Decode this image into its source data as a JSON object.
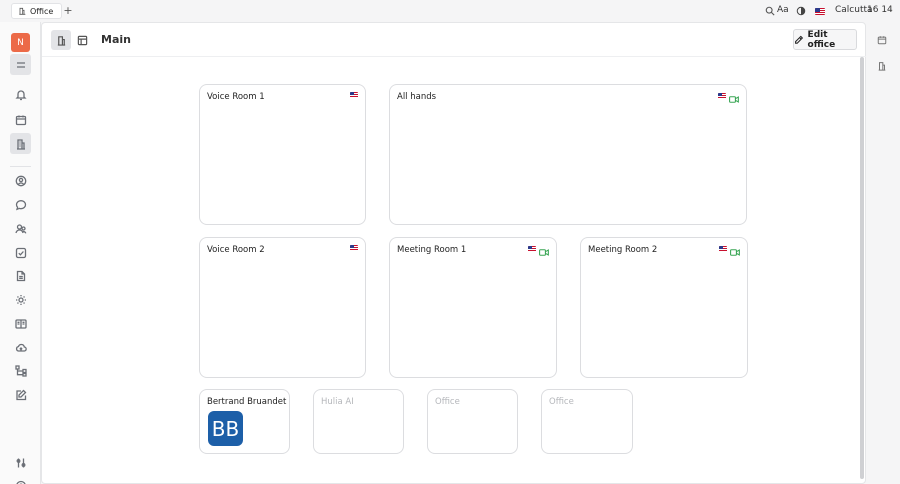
{
  "topbar": {
    "tab_label": "Office",
    "new_tab": "+",
    "font_size_label": "Aa",
    "location": "Calcutta",
    "time": "16 14"
  },
  "header": {
    "title": "Main",
    "edit_label": "Edit office"
  },
  "rooms": [
    {
      "name": "Voice Room 1",
      "flag": true,
      "video": false
    },
    {
      "name": "All hands",
      "flag": true,
      "video": true
    },
    {
      "name": "Voice Room 2",
      "flag": true,
      "video": false
    },
    {
      "name": "Meeting Room 1",
      "flag": true,
      "video": true
    },
    {
      "name": "Meeting Room 2",
      "flag": true,
      "video": true
    }
  ],
  "desks": [
    {
      "name": "Bertrand Bruandet",
      "initials": "BB",
      "muted": false
    },
    {
      "name": "Hulia AI",
      "muted": true
    },
    {
      "name": "Office",
      "muted": true
    },
    {
      "name": "Office",
      "muted": true
    }
  ],
  "sidebar": {
    "workspace_initial": "N",
    "items": [
      "menu-icon",
      "bell-icon",
      "calendar-icon",
      "office-icon",
      "contact-icon",
      "chat-icon",
      "people-icon",
      "tasks-icon",
      "document-icon",
      "sun-icon",
      "book-icon",
      "cloud-icon",
      "hierarchy-icon",
      "edit-icon",
      "settings-icon",
      "help-icon"
    ]
  },
  "colors": {
    "workspace_avatar": "#ec6a48",
    "user_avatar": "#1d5fa8",
    "video_icon": "#3aa655"
  }
}
